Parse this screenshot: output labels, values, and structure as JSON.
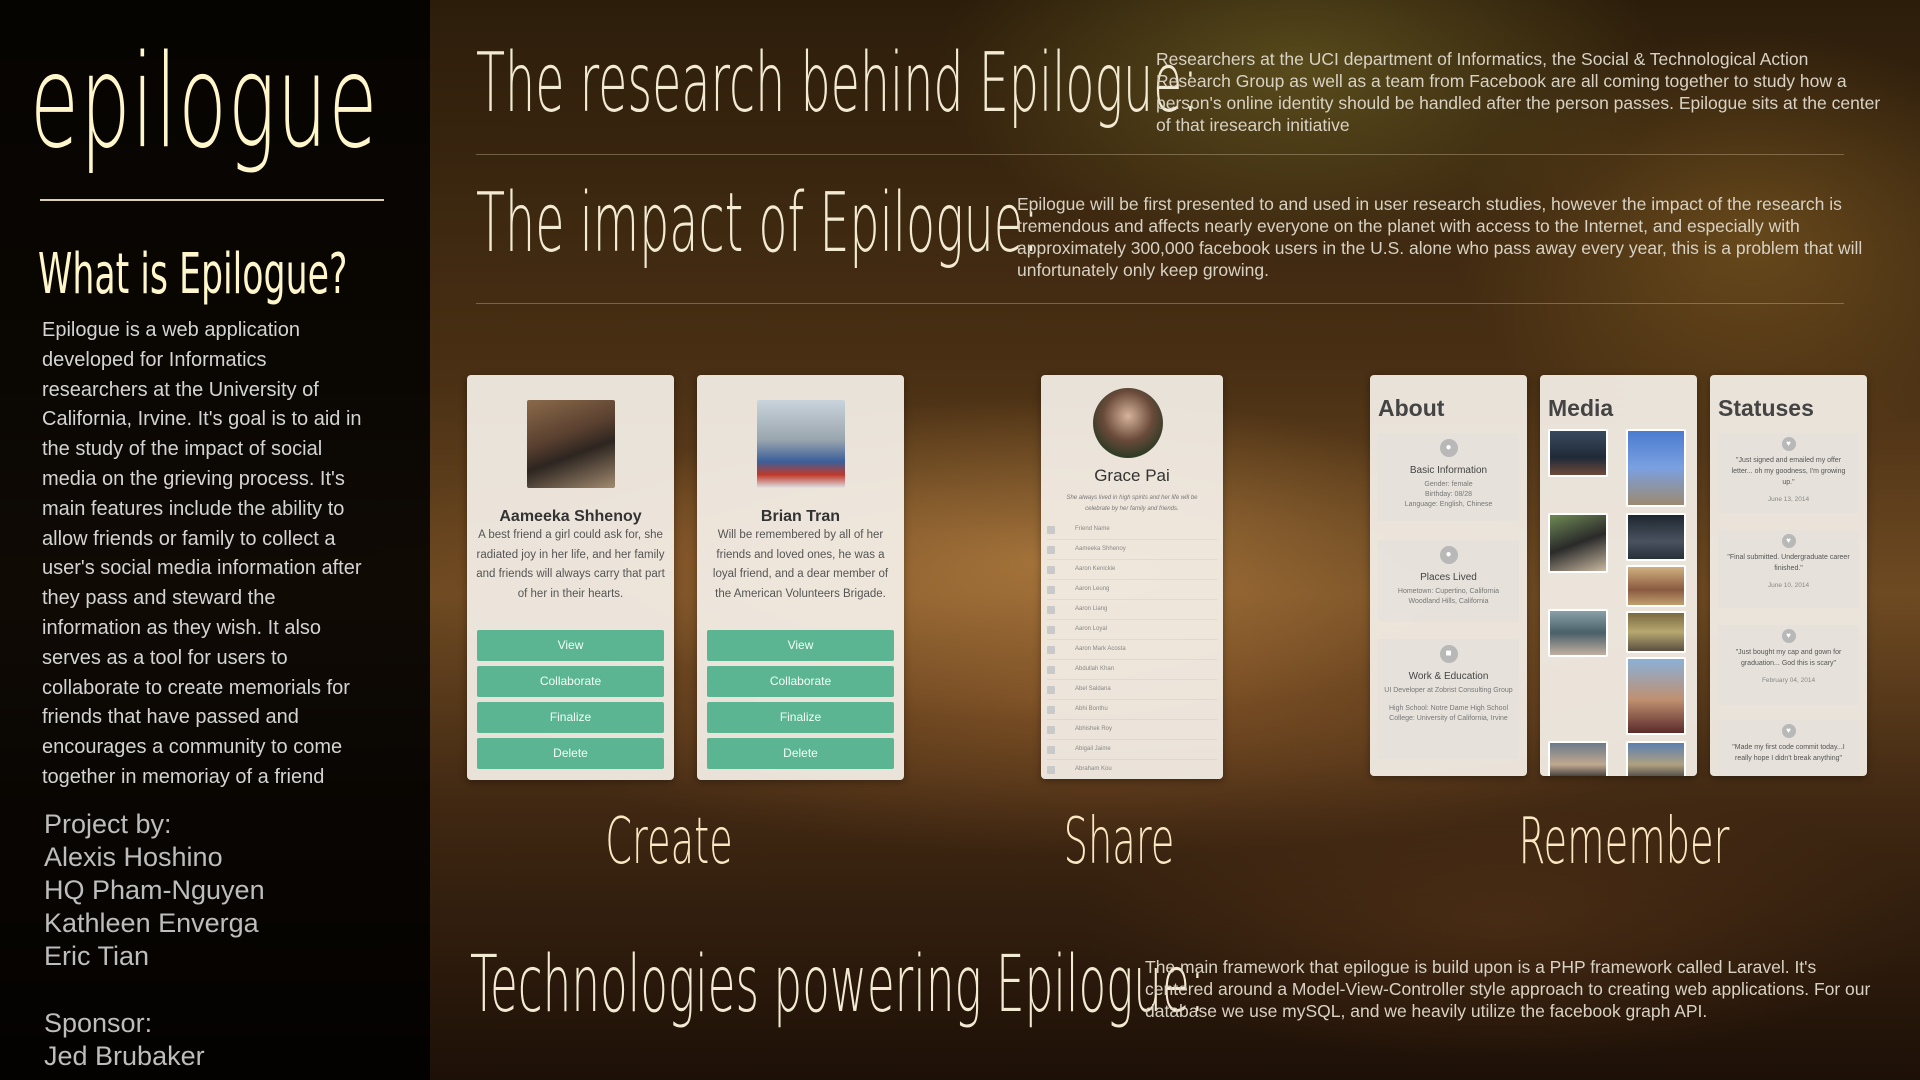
{
  "sidebar": {
    "logo": "epilogue",
    "what_title": "What is Epilogue?",
    "what_body": "Epilogue is a web application developed for Informatics researchers at the University of California, Irvine. It's goal is to aid in the study of the impact of social media on the grieving process. It's main features include the ability to allow friends or family to collect a user's social media information after they pass and steward the information as they wish. It also serves as a tool for users to collaborate to create memorials for friends that have passed and encourages a community to come together in memoriay of a friend",
    "project_label": "Project by:",
    "authors": [
      "Alexis Hoshino",
      "HQ Pham-Nguyen",
      "Kathleen Enverga",
      "Eric Tian"
    ],
    "sponsor_label": "Sponsor:",
    "sponsor": "Jed Brubaker"
  },
  "research": {
    "heading": "The research behind Epilogue:",
    "body": "Researchers at the UCI department of Informatics, the Social & Technological Action Research Group as well as a team from Facebook are all coming together to study how a person's online identity should be handled after the person passes. Epilogue sits at the center of that iresearch initiative"
  },
  "impact": {
    "heading": "The impact of Epilogue:",
    "body": "Epilogue will be first presented to and used in user research studies, however the impact of the research is tremendous and affects nearly everyone on the planet with access to the Internet, and especially with approximately 300,000 facebook users in the U.S. alone who pass away every year, this is a problem that will unfortunately only keep growing."
  },
  "tech": {
    "heading": "Technologies powering Epilogue:",
    "body": "The main framework that epilogue is build upon is a PHP framework called Laravel. It's centered around a Model-View-Controller style approach to creating web applications. For our database we use mySQL, and we heavily utilize the facebook graph API."
  },
  "section_labels": {
    "create": "Create",
    "share": "Share",
    "remember": "Remember"
  },
  "create_cards": [
    {
      "name": "Aameeka Shhenoy",
      "desc": "A best friend a girl could ask for, she radiated joy in her life, and her family and friends will always carry that part of her in their hearts.",
      "buttons": [
        "View",
        "Collaborate",
        "Finalize",
        "Delete"
      ]
    },
    {
      "name": "Brian Tran",
      "desc": "Will be remembered by all of her friends and loved ones, he was a loyal friend, and a dear member of the American Volunteers Brigade.",
      "buttons": [
        "View",
        "Collaborate",
        "Finalize",
        "Delete"
      ]
    }
  ],
  "share_card": {
    "name": "Grace Pai",
    "desc": "She always lived in high spirits and her life will be celebrate by her family and friends.",
    "list_header": "Friend Name",
    "friends": [
      "Aameeka Shhenoy",
      "Aaron Kenickie",
      "Aaron Leung",
      "Aaron Liang",
      "Aaron Loyal",
      "Aaron Mark Acosta",
      "Abdullah Khan",
      "Abel Saldana",
      "Abhi Bonthu",
      "Abhishek Roy",
      "Abigail Jaime",
      "Abraham Kou"
    ]
  },
  "about": {
    "title": "About",
    "sections": [
      {
        "icon": "person-icon",
        "heading": "Basic Information",
        "lines": [
          "Gender: female",
          "Birthday: 08/28",
          "Language: English, Chinese"
        ]
      },
      {
        "icon": "globe-icon",
        "heading": "Places Lived",
        "lines": [
          "Hometown: Cupertino, California",
          "Woodland Hills, California"
        ]
      },
      {
        "icon": "building-icon",
        "heading": "Work & Education",
        "lines": [
          "UI Developer at Zobrist Consulting Group",
          "",
          "High School: Notre Dame High School",
          "College: University of California, Irvine"
        ]
      }
    ]
  },
  "media": {
    "title": "Media"
  },
  "statuses": {
    "title": "Statuses",
    "items": [
      {
        "text": "\"Just signed and emailed my offer letter... oh my goodness, I'm growing up.\"",
        "date": "June 13, 2014"
      },
      {
        "text": "\"Final submitted. Undergraduate career finished.\"",
        "date": "June 10, 2014"
      },
      {
        "text": "\"Just bought my cap and gown for graduation... God this is scary\"",
        "date": "February 04, 2014"
      },
      {
        "text": "\"Made my first code commit today...I really hope I didn't break anything\"",
        "date": ""
      }
    ]
  }
}
